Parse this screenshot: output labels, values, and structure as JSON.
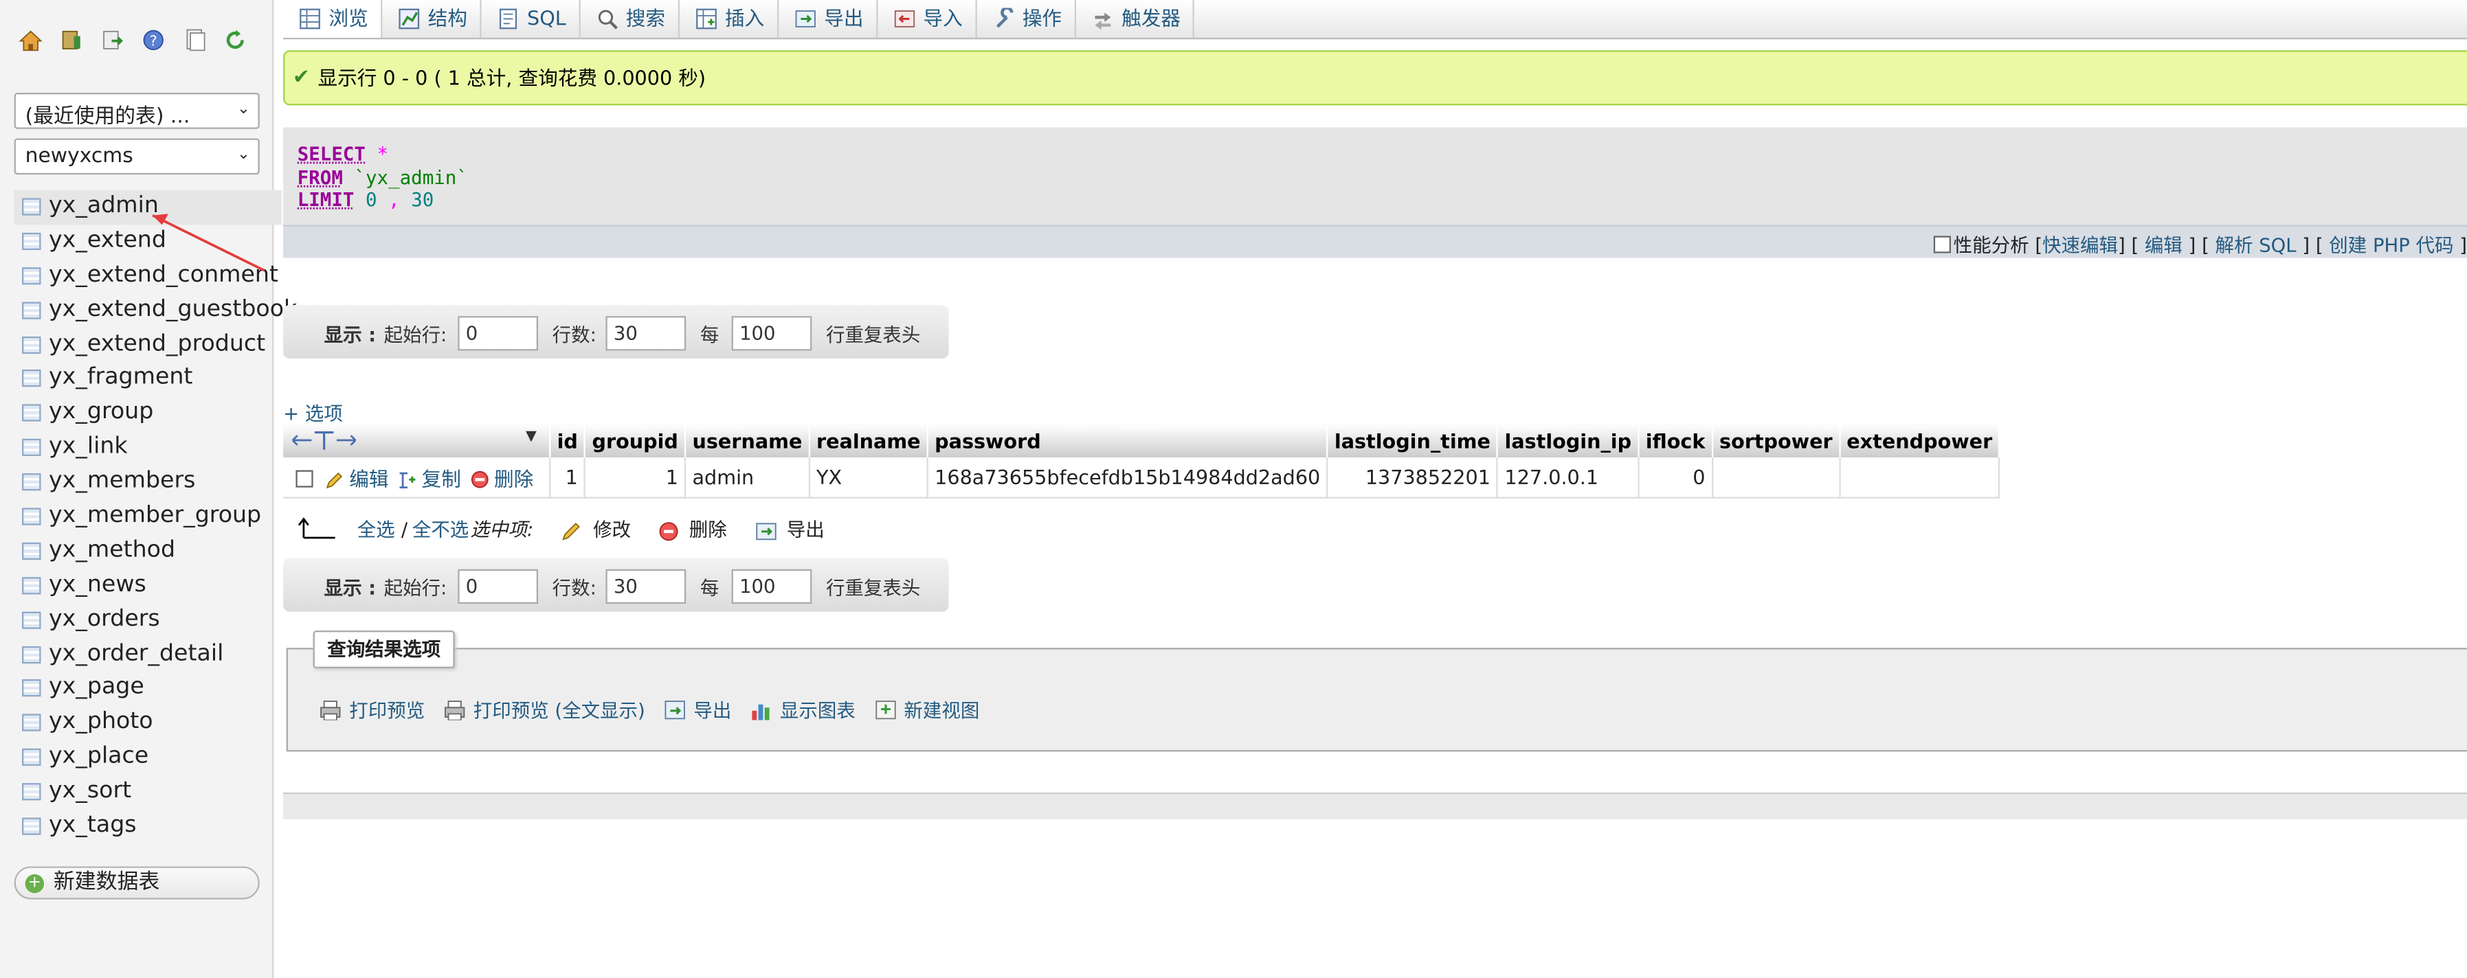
{
  "nav": {
    "icons": [
      "home-icon",
      "database-icon",
      "exit-icon",
      "help-icon",
      "docs-icon",
      "reload-icon"
    ],
    "recent_select": "(最近使用的表) ...",
    "db_select": "newyxcms",
    "tables": [
      "yx_admin",
      "yx_extend",
      "yx_extend_conment",
      "yx_extend_guestbook",
      "yx_extend_product",
      "yx_fragment",
      "yx_group",
      "yx_link",
      "yx_members",
      "yx_member_group",
      "yx_method",
      "yx_news",
      "yx_orders",
      "yx_order_detail",
      "yx_page",
      "yx_photo",
      "yx_place",
      "yx_sort",
      "yx_tags"
    ],
    "active_table": "yx_admin",
    "new_table": "新建数据表"
  },
  "tabs": [
    {
      "label": "浏览",
      "icon": "browse-icon"
    },
    {
      "label": "结构",
      "icon": "structure-icon"
    },
    {
      "label": "SQL",
      "icon": "sql-icon"
    },
    {
      "label": "搜索",
      "icon": "search-icon"
    },
    {
      "label": "插入",
      "icon": "insert-icon"
    },
    {
      "label": "导出",
      "icon": "export-icon"
    },
    {
      "label": "导入",
      "icon": "import-icon"
    },
    {
      "label": "操作",
      "icon": "operations-icon"
    },
    {
      "label": "触发器",
      "icon": "triggers-icon"
    }
  ],
  "success": "显示行 0 - 0 ( 1 总计, 查询花费 0.0000 秒)",
  "sql": {
    "select": "SELECT",
    "star": "*",
    "from": "FROM",
    "table": "`yx_admin`",
    "limit": "LIMIT",
    "offset": "0",
    "comma": ",",
    "count": "30"
  },
  "sql_links": {
    "profiling": "性能分析",
    "inline_edit": "快速编辑",
    "edit": "编辑",
    "explain": "解析 SQL",
    "php": "创建 PHP 代码"
  },
  "navform": {
    "show": "显示 :",
    "start_label": "起始行:",
    "start_value": "0",
    "rows_label": "行数:",
    "rows_value": "30",
    "per_label": "每",
    "per_value": "100",
    "repeat_label": "行重复表头"
  },
  "options": "+ 选项",
  "table": {
    "columns": [
      "id",
      "groupid",
      "username",
      "realname",
      "password",
      "lastlogin_time",
      "lastlogin_ip",
      "iflock",
      "sortpower",
      "extendpower"
    ],
    "actions": {
      "edit": "编辑",
      "copy": "复制",
      "delete": "删除"
    },
    "rows": [
      {
        "id": "1",
        "groupid": "1",
        "username": "admin",
        "realname": "YX",
        "password": "168a73655bfecefdb15b14984dd2ad60",
        "lastlogin_time": "1373852201",
        "lastlogin_ip": "127.0.0.1",
        "iflock": "0",
        "sortpower": "",
        "extendpower": ""
      }
    ]
  },
  "multi": {
    "check_all": "全选",
    "sep": "/",
    "uncheck_all": "全不选",
    "with_selected": "选中项:",
    "change": "修改",
    "delete": "删除",
    "export": "导出"
  },
  "query_ops": {
    "legend": "查询结果选项",
    "print": "打印预览",
    "print_full": "打印预览 (全文显示)",
    "export": "导出",
    "chart": "显示图表",
    "create_view": "新建视图"
  }
}
